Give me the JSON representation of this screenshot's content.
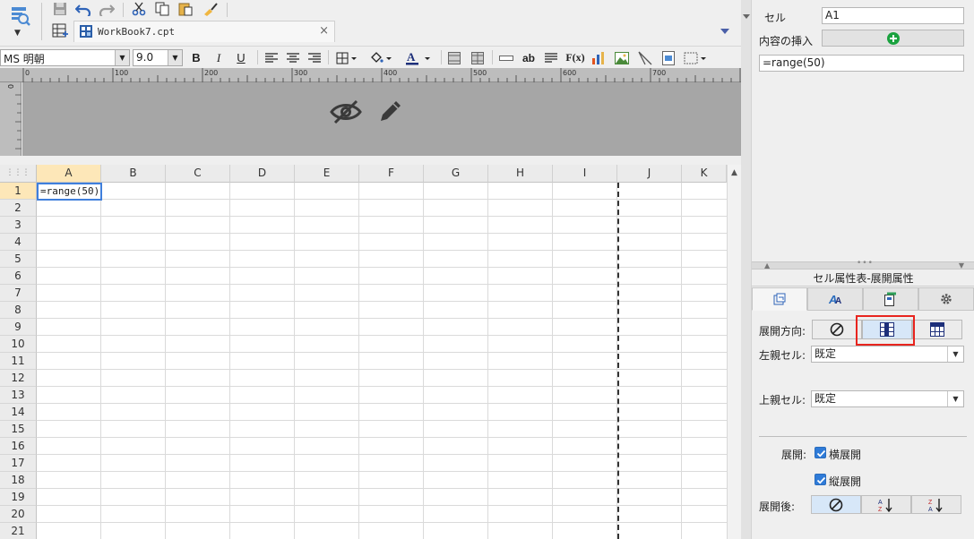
{
  "toolbar": {
    "icons": [
      "preview-icon",
      "save-icon",
      "undo-icon",
      "redo-icon",
      "cut-icon",
      "copy-icon",
      "paste-icon",
      "format-painter-icon"
    ]
  },
  "file_tab": {
    "name": "WorkBook7.cpt",
    "close": "×"
  },
  "format_bar": {
    "font_family": "MS 明朝",
    "font_size": "9.0",
    "bold": "B",
    "italic": "I",
    "underline": "U",
    "text_ab": "ab",
    "formula": "F(x)"
  },
  "ruler": {
    "marks": [
      "0",
      "100",
      "200",
      "300",
      "400",
      "500",
      "600",
      "700"
    ],
    "vertical_mark": "0"
  },
  "grid": {
    "corner": "⋮⋮⋮",
    "columns": [
      "A",
      "B",
      "C",
      "D",
      "E",
      "F",
      "G",
      "H",
      "I",
      "J",
      "K"
    ],
    "rows": [
      "1",
      "2",
      "3",
      "4",
      "5",
      "6",
      "7",
      "8",
      "9",
      "10",
      "11",
      "12",
      "13",
      "14",
      "15",
      "16",
      "17",
      "18",
      "19",
      "20",
      "21"
    ],
    "selected_column": "A",
    "selected_row": "1",
    "a1_value": "=range(50)"
  },
  "right_panel": {
    "cell_label": "セル",
    "cell_value": "A1",
    "insert_label": "内容の挿入",
    "formula_value": "=range(50)",
    "panel_title": "セル属性表-展開属性",
    "expand_direction_label": "展開方向:",
    "left_parent_label": "左親セル:",
    "left_parent_value": "既定",
    "top_parent_label": "上親セル:",
    "top_parent_value": "既定",
    "expand_label": "展開:",
    "horizontal_expand_label": "横展開",
    "vertical_expand_label": "縦展開",
    "after_expand_label": "展開後:",
    "colors": {
      "accent": "#2f7bd8",
      "highlight": "#e8241e",
      "insert_plus": "#1aa23f"
    }
  }
}
